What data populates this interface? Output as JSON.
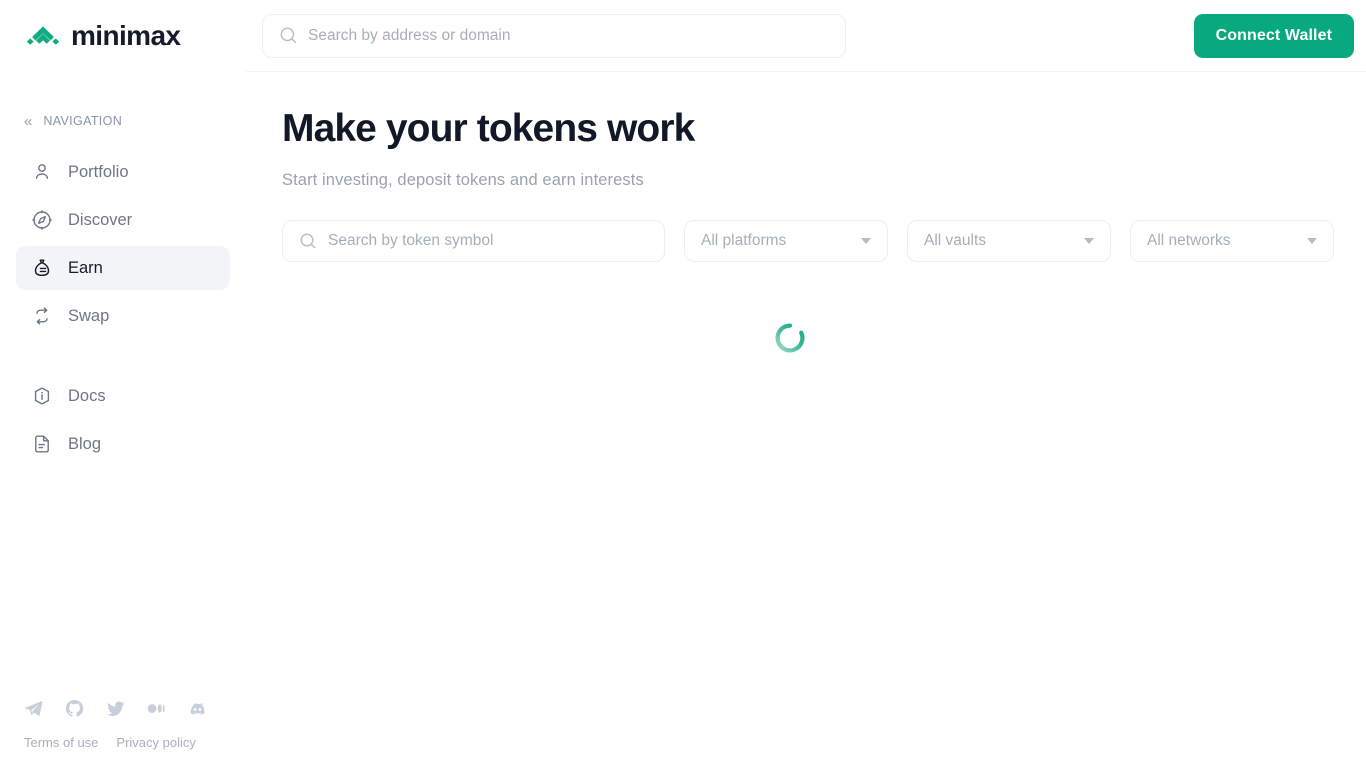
{
  "brand": {
    "name": "minimax",
    "logo_icon": "double-chevron-up-logo",
    "accent_color": "#0eac83"
  },
  "sidebar": {
    "nav_header": {
      "label": "NAVIGATION",
      "collapse_icon": "double-chevron-left-icon"
    },
    "items": [
      {
        "label": "Portfolio",
        "icon": "user-icon",
        "active": false
      },
      {
        "label": "Discover",
        "icon": "compass-icon",
        "active": false
      },
      {
        "label": "Earn",
        "icon": "money-bag-icon",
        "active": true
      },
      {
        "label": "Swap",
        "icon": "swap-arrows-icon",
        "active": false
      }
    ],
    "secondary_items": [
      {
        "label": "Docs",
        "icon": "info-hexagon-icon"
      },
      {
        "label": "Blog",
        "icon": "document-lines-icon"
      }
    ],
    "socials": [
      {
        "name": "telegram-icon"
      },
      {
        "name": "github-icon"
      },
      {
        "name": "twitter-icon"
      },
      {
        "name": "medium-icon"
      },
      {
        "name": "discord-icon"
      }
    ],
    "legal": [
      {
        "label": "Terms of use"
      },
      {
        "label": "Privacy policy"
      }
    ]
  },
  "topbar": {
    "search": {
      "placeholder": "Search by address or domain",
      "value": "",
      "icon": "search-icon"
    },
    "connect_wallet_label": "Connect Wallet"
  },
  "page": {
    "title": "Make your tokens work",
    "subtitle": "Start investing, deposit tokens and earn interests"
  },
  "filters": {
    "token_search": {
      "placeholder": "Search by token symbol",
      "value": "",
      "icon": "search-icon"
    },
    "selects": [
      {
        "name": "platforms",
        "selected": "All platforms"
      },
      {
        "name": "vaults",
        "selected": "All vaults"
      },
      {
        "name": "networks",
        "selected": "All networks"
      }
    ]
  },
  "loading": {
    "state": "loading",
    "icon": "circular-spinner"
  }
}
